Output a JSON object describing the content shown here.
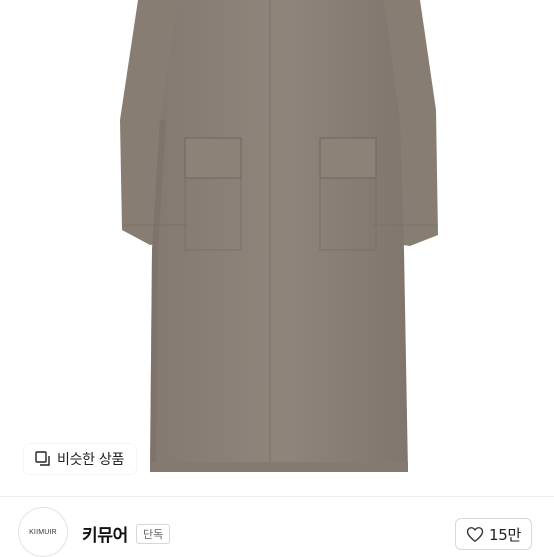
{
  "product_image": {
    "alt": ""
  },
  "similar_button": {
    "icon": "similar-items-icon",
    "label": "비슷한 상품"
  },
  "brand": {
    "logo_text": "KIIMUIR",
    "name": "키뮤어",
    "badge": "단독"
  },
  "like_button": {
    "icon": "heart-icon",
    "count": "15만"
  },
  "colors": {
    "coat": "#8d8379",
    "coat_shadow": "#786e65",
    "text": "#222222",
    "border": "#d9d9d9"
  }
}
